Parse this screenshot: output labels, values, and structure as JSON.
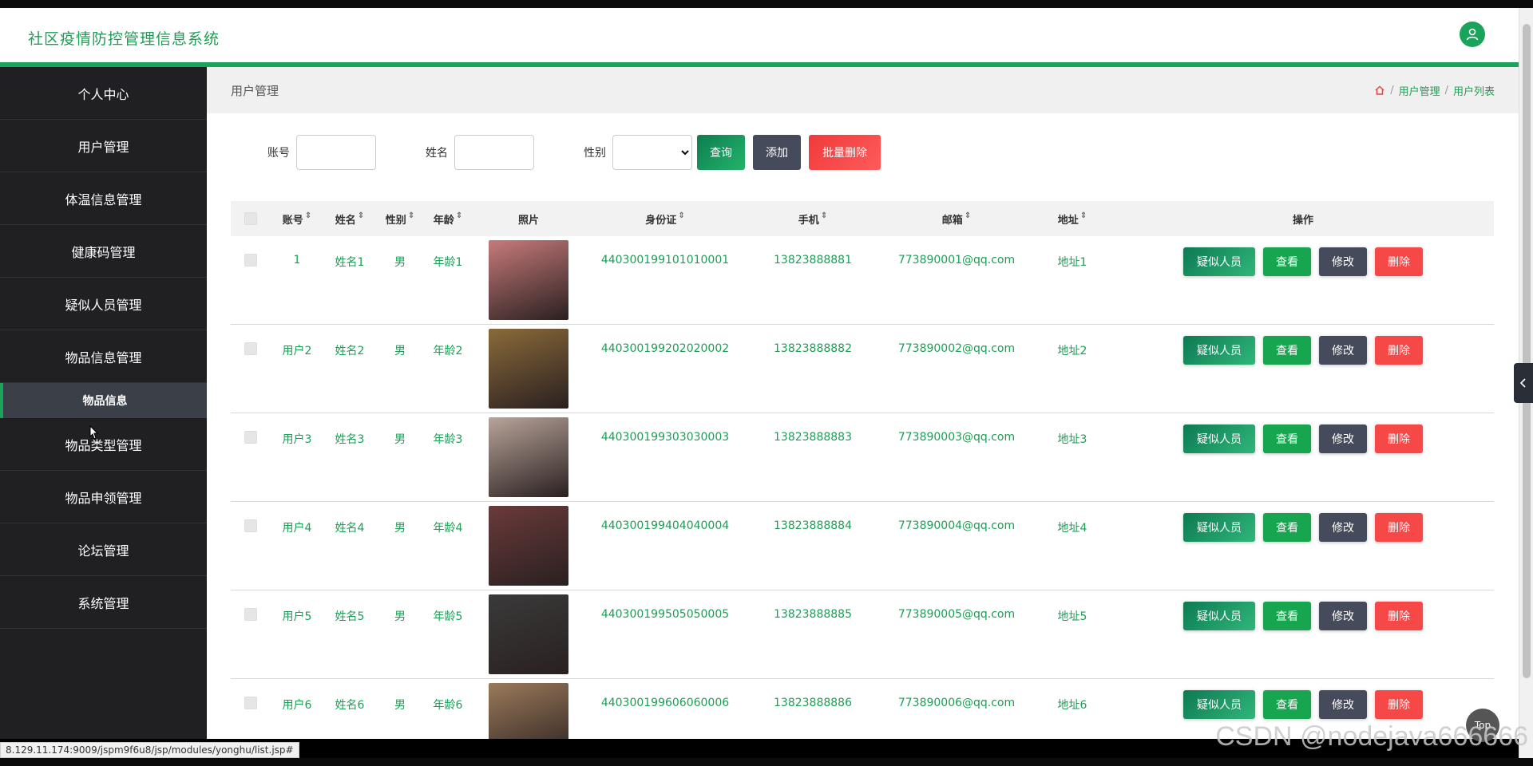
{
  "app": {
    "title": "社区疫情防控管理信息系统"
  },
  "sidebar": {
    "items": [
      {
        "label": "个人中心"
      },
      {
        "label": "用户管理"
      },
      {
        "label": "体温信息管理"
      },
      {
        "label": "健康码管理"
      },
      {
        "label": "疑似人员管理"
      },
      {
        "label": "物品信息管理"
      },
      {
        "label": "物品信息",
        "sub": true
      },
      {
        "label": "物品类型管理"
      },
      {
        "label": "物品申领管理"
      },
      {
        "label": "论坛管理"
      },
      {
        "label": "系统管理"
      }
    ]
  },
  "page": {
    "title": "用户管理",
    "breadcrumb": [
      "用户管理",
      "用户列表"
    ]
  },
  "search": {
    "account_label": "账号",
    "name_label": "姓名",
    "gender_label": "性别",
    "query_label": "查询",
    "add_label": "添加",
    "batch_delete_label": "批量删除"
  },
  "table": {
    "headers": [
      "账号",
      "姓名",
      "性别",
      "年龄",
      "照片",
      "身份证",
      "手机",
      "邮箱",
      "地址",
      "操作"
    ],
    "ops": {
      "suspect": "疑似人员",
      "view": "查看",
      "edit": "修改",
      "delete": "删除"
    },
    "rows": [
      {
        "account": "1",
        "name": "姓名1",
        "gender": "男",
        "age": "年龄1",
        "id": "440300199101010001",
        "phone": "13823888881",
        "email": "773890001@qq.com",
        "address": "地址1",
        "photo_color": "#c77a7a"
      },
      {
        "account": "用户2",
        "name": "姓名2",
        "gender": "男",
        "age": "年龄2",
        "id": "440300199202020002",
        "phone": "13823888882",
        "email": "773890002@qq.com",
        "address": "地址2",
        "photo_color": "#8a6a3a"
      },
      {
        "account": "用户3",
        "name": "姓名3",
        "gender": "男",
        "age": "年龄3",
        "id": "440300199303030003",
        "phone": "13823888883",
        "email": "773890003@qq.com",
        "address": "地址3",
        "photo_color": "#b8a49a"
      },
      {
        "account": "用户4",
        "name": "姓名4",
        "gender": "男",
        "age": "年龄4",
        "id": "440300199404040004",
        "phone": "13823888884",
        "email": "773890004@qq.com",
        "address": "地址4",
        "photo_color": "#6a3a3a"
      },
      {
        "account": "用户5",
        "name": "姓名5",
        "gender": "男",
        "age": "年龄5",
        "id": "440300199505050005",
        "phone": "13823888885",
        "email": "773890005@qq.com",
        "address": "地址5",
        "photo_color": "#3a3a3a"
      },
      {
        "account": "用户6",
        "name": "姓名6",
        "gender": "男",
        "age": "年龄6",
        "id": "440300199606060006",
        "phone": "13823888886",
        "email": "773890006@qq.com",
        "address": "地址6",
        "photo_color": "#9a7a5a"
      }
    ]
  },
  "status_url": "8.129.11.174:9009/jspm9f6u8/jsp/modules/yonghu/list.jsp#",
  "watermark": "CSDN @nodejava666666",
  "top_button": "Top",
  "colors": {
    "accent": "#1aa35a",
    "sidebar": "#202023",
    "danger": "#f74848",
    "dark": "#454b5a"
  }
}
